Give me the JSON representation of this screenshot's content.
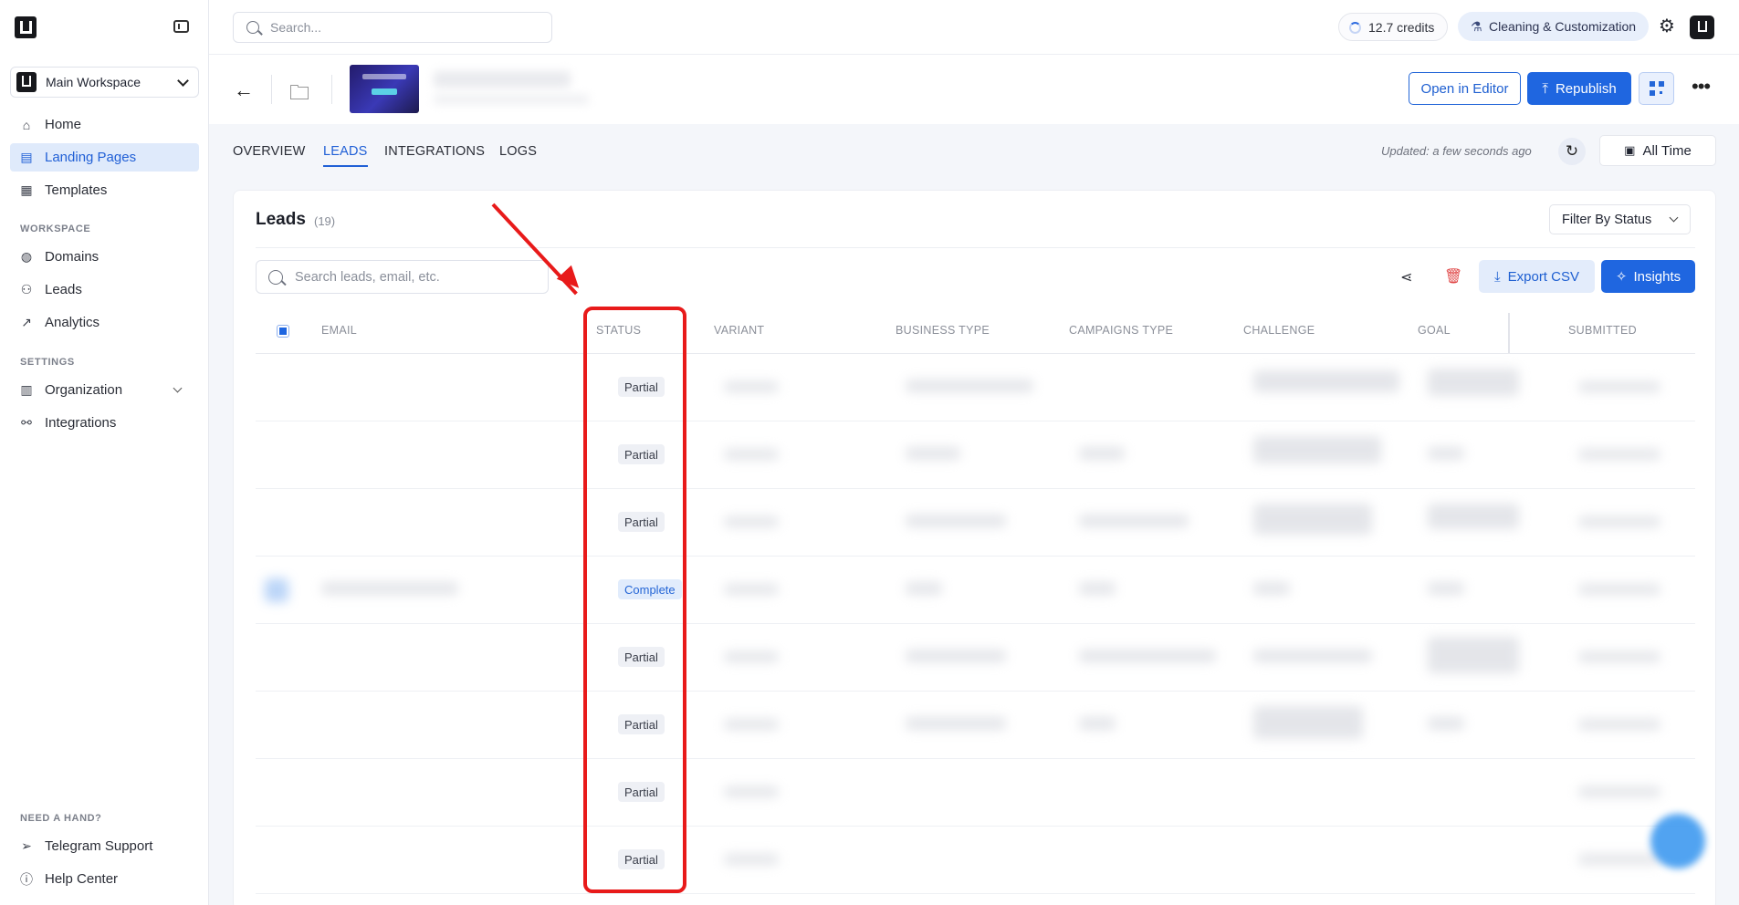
{
  "sidebar": {
    "workspace": "Main Workspace",
    "nav_main": [
      {
        "label": "Home",
        "icon": "home-icon"
      },
      {
        "label": "Landing Pages",
        "icon": "page-icon",
        "active": true
      },
      {
        "label": "Templates",
        "icon": "template-icon"
      }
    ],
    "workspace_section": "WORKSPACE",
    "nav_workspace": [
      {
        "label": "Domains",
        "icon": "globe-icon"
      },
      {
        "label": "Leads",
        "icon": "users-icon"
      },
      {
        "label": "Analytics",
        "icon": "chart-icon"
      }
    ],
    "settings_section": "SETTINGS",
    "nav_settings": [
      {
        "label": "Organization",
        "icon": "building-icon"
      },
      {
        "label": "Integrations",
        "icon": "integrations-icon"
      }
    ],
    "help_section": "NEED A HAND?",
    "nav_help": [
      {
        "label": "Telegram Support",
        "icon": "send-icon"
      },
      {
        "label": "Help Center",
        "icon": "help-icon"
      }
    ]
  },
  "topbar": {
    "search_placeholder": "Search...",
    "credits": "12.7 credits",
    "project": "Cleaning & Customization"
  },
  "header": {
    "open_editor": "Open in Editor",
    "republish": "Republish"
  },
  "tabs": {
    "overview": "OVERVIEW",
    "leads": "LEADS",
    "integrations": "INTEGRATIONS",
    "logs": "LOGS"
  },
  "toolbar": {
    "updated": "Updated: a few seconds ago",
    "range": "All Time"
  },
  "leads": {
    "title": "Leads",
    "count": "(19)",
    "filter": "Filter By Status",
    "search_placeholder": "Search leads, email, etc.",
    "export": "Export CSV",
    "insights": "Insights"
  },
  "table": {
    "columns": {
      "email": "EMAIL",
      "status": "STATUS",
      "variant": "VARIANT",
      "business_type": "BUSINESS TYPE",
      "campaigns_type": "CAMPAIGNS TYPE",
      "challenge": "CHALLENGE",
      "goal": "GOAL",
      "submitted": "SUBMITTED"
    },
    "rows": [
      {
        "status": "Partial"
      },
      {
        "status": "Partial"
      },
      {
        "status": "Partial"
      },
      {
        "status": "Complete"
      },
      {
        "status": "Partial"
      },
      {
        "status": "Partial"
      },
      {
        "status": "Partial"
      },
      {
        "status": "Partial"
      }
    ]
  },
  "colors": {
    "accent": "#1f66e0",
    "annotation": "#e81a1a"
  }
}
